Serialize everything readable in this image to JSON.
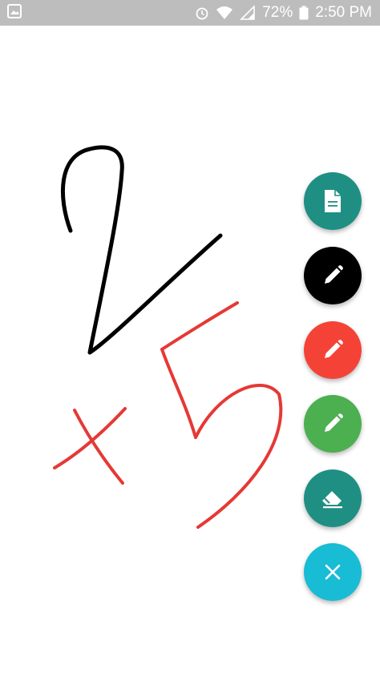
{
  "status_bar": {
    "battery": "72%",
    "time": "2:50 PM",
    "icons": [
      "gallery-notification-icon",
      "alarm-icon",
      "wifi-icon",
      "signal-icon",
      "battery-icon"
    ]
  },
  "drawing": {
    "strokes": [
      {
        "color": "#000000",
        "depicts": "2"
      },
      {
        "color": "#e53935",
        "depicts": "x"
      },
      {
        "color": "#e53935",
        "depicts": "5"
      }
    ]
  },
  "fab_menu": {
    "buttons": [
      {
        "icon": "new-page-icon",
        "color": "#1f8f84"
      },
      {
        "icon": "pencil-icon",
        "color": "#000000"
      },
      {
        "icon": "pencil-icon",
        "color": "#f44336"
      },
      {
        "icon": "pencil-icon",
        "color": "#4caf50"
      },
      {
        "icon": "eraser-icon",
        "color": "#1f8f84"
      },
      {
        "icon": "close-icon",
        "color": "#18bcd4"
      }
    ]
  }
}
